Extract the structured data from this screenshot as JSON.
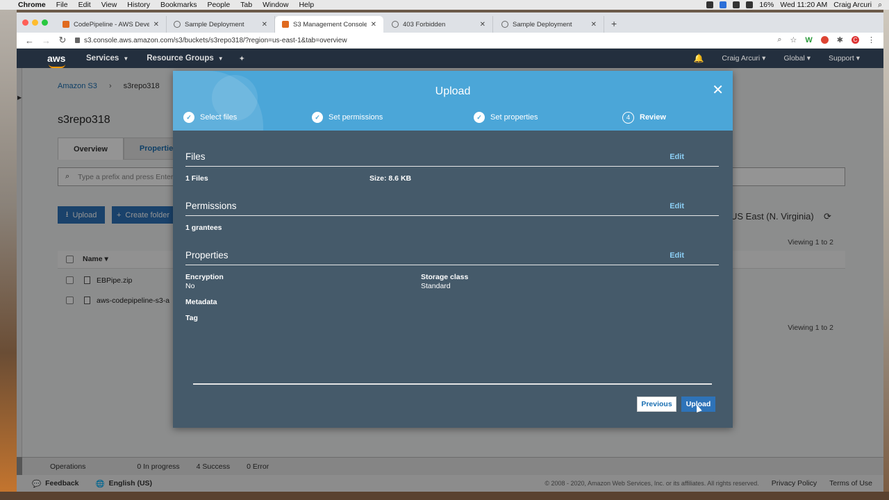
{
  "mac_menubar": {
    "app": "Chrome",
    "items": [
      "File",
      "Edit",
      "View",
      "History",
      "Bookmarks",
      "People",
      "Tab",
      "Window",
      "Help"
    ],
    "battery": "16%",
    "clock": "Wed 11:20 AM",
    "user": "Craig Arcuri"
  },
  "browser": {
    "tabs": [
      {
        "label": "CodePipeline - AWS Developer",
        "favicon": "aws-icon"
      },
      {
        "label": "Sample Deployment",
        "favicon": "globe-icon"
      },
      {
        "label": "S3 Management Console",
        "favicon": "aws-icon",
        "active": true
      },
      {
        "label": "403 Forbidden",
        "favicon": "globe-icon"
      },
      {
        "label": "Sample Deployment",
        "favicon": "globe-icon"
      }
    ],
    "url": "s3.console.aws.amazon.com/s3/buckets/s3repo318/?region=us-east-1&tab=overview"
  },
  "aws_header": {
    "logo": "aws",
    "services": "Services",
    "resource_groups": "Resource Groups",
    "user": "Craig Arcuri",
    "region": "Global",
    "support": "Support"
  },
  "page": {
    "breadcrumb_root": "Amazon S3",
    "breadcrumb_bucket": "s3repo318",
    "bucket_title": "s3repo318",
    "tab_overview": "Overview",
    "tab_properties": "Properties",
    "search_placeholder": "Type a prefix and press Enter",
    "upload_button": "Upload",
    "create_folder_button": "Create folder",
    "region_label": "US East (N. Virginia)",
    "viewing_top": "Viewing 1 to 2",
    "viewing_bottom": "Viewing 1 to 2",
    "column_name": "Name",
    "files": [
      "EBPipe.zip",
      "aws-codepipeline-s3-a"
    ]
  },
  "statusbar": {
    "operations": "Operations",
    "in_progress": "0 In progress",
    "success": "4 Success",
    "error": "0 Error"
  },
  "footer": {
    "feedback": "Feedback",
    "language": "English (US)",
    "copyright": "© 2008 - 2020, Amazon Web Services, Inc. or its affiliates. All rights reserved.",
    "privacy": "Privacy Policy",
    "terms": "Terms of Use"
  },
  "modal": {
    "title": "Upload",
    "steps": [
      {
        "label": "Select files",
        "state": "done"
      },
      {
        "label": "Set permissions",
        "state": "done"
      },
      {
        "label": "Set properties",
        "state": "done"
      },
      {
        "label": "Review",
        "state": "current",
        "number": "4"
      }
    ],
    "files_section": {
      "title": "Files",
      "edit": "Edit",
      "count": "1 Files",
      "size": "Size: 8.6 KB"
    },
    "permissions_section": {
      "title": "Permissions",
      "edit": "Edit",
      "grantees": "1 grantees"
    },
    "properties_section": {
      "title": "Properties",
      "edit": "Edit",
      "encryption_label": "Encryption",
      "encryption_value": "No",
      "storage_class_label": "Storage class",
      "storage_class_value": "Standard",
      "metadata_label": "Metadata",
      "tag_label": "Tag"
    },
    "previous_button": "Previous",
    "upload_button": "Upload"
  },
  "colors": {
    "aws_header": "#232f3e",
    "modal_header": "#4ba6d8",
    "modal_body": "#455a6a",
    "primary_button": "#2e73b8",
    "link": "#1a6fb2"
  }
}
